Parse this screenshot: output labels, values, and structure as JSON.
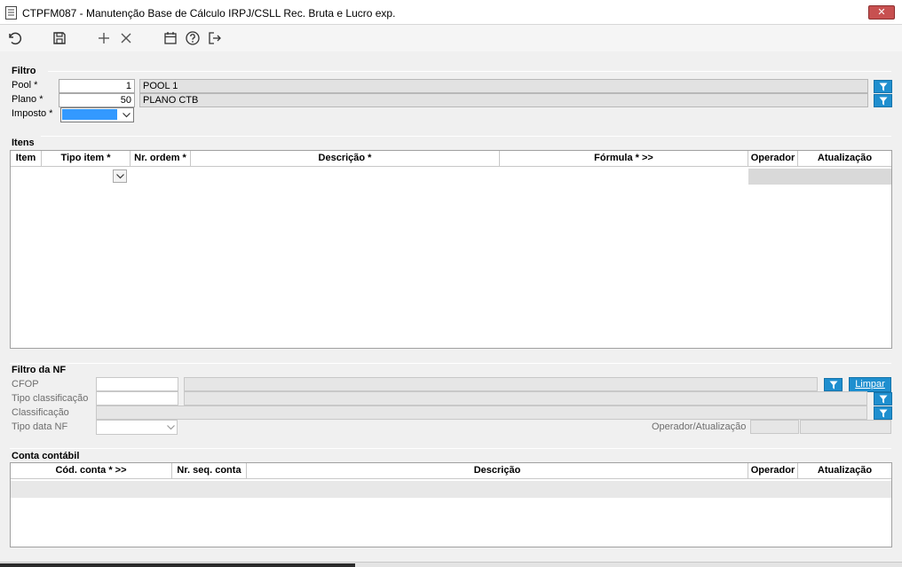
{
  "window": {
    "title": "CTPFM087 - Manutenção Base de Cálculo IRPJ/CSLL Rec. Bruta e Lucro exp.",
    "close_glyph": "✕"
  },
  "toolbar": {
    "icons": [
      "undo-icon",
      "save-icon",
      "add-icon",
      "delete-icon",
      "calendar-icon",
      "help-icon",
      "exit-icon"
    ]
  },
  "filtro": {
    "title": "Filtro",
    "pool": {
      "label": "Pool *",
      "value": "1",
      "description": "POOL 1"
    },
    "plano": {
      "label": "Plano *",
      "value": "50",
      "description": "PLANO CTB"
    },
    "imposto": {
      "label": "Imposto *",
      "value": ""
    }
  },
  "itens": {
    "title": "Itens",
    "columns": [
      "Item",
      "Tipo item *",
      "Nr. ordem *",
      "Descrição *",
      "Fórmula * >>",
      "Operador",
      "Atualização"
    ],
    "rows": []
  },
  "filtro_nf": {
    "title": "Filtro da NF",
    "cfop_label": "CFOP",
    "tipo_classificacao_label": "Tipo classificação",
    "classificacao_label": "Classificação",
    "tipo_data_label": "Tipo data NF",
    "operador_atualizacao_label": "Operador/Atualização",
    "limpar_label": "Limpar"
  },
  "conta_contabil": {
    "title": "Conta contábil",
    "columns": [
      "Cód. conta * >>",
      "Nr. seq. conta",
      "Descrição",
      "Operador",
      "Atualização"
    ],
    "rows": []
  },
  "colors": {
    "accent": "#1f8fcf",
    "selection": "#3399ff",
    "close": "#c75050"
  }
}
